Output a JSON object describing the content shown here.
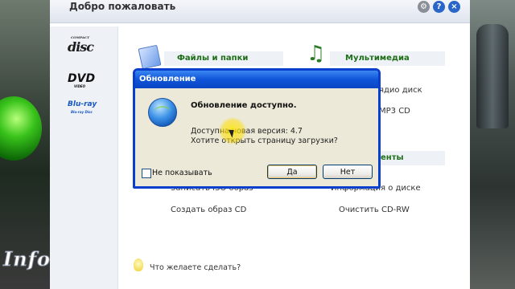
{
  "app": {
    "title": "Добро пожаловать"
  },
  "titlebar_icons": [
    "gear-icon",
    "help-icon",
    "close-icon"
  ],
  "sidebar": {
    "logos": [
      {
        "name": "compact-disc-logo",
        "text": "disc",
        "sub": "COMPACT"
      },
      {
        "name": "dvd-logo",
        "text": "DVD",
        "sub": "VIDEO"
      },
      {
        "name": "bluray-logo",
        "text": "Blu-ray",
        "sub": "Blu-ray Disc"
      }
    ],
    "watermark": "Info"
  },
  "sections": {
    "files": {
      "title": "Файлы и папки",
      "icon": "folder-icon"
    },
    "multimedia": {
      "title": "Мультимедиа",
      "icon": "music-note-icon"
    },
    "third_header_fragment": "енты"
  },
  "tasks": {
    "audio_disc_fragment": "ядио диск",
    "mp3_fragment": "MP3 CD",
    "image_fragment": "Записать ISO образ",
    "disc_info_fragment": "Информация о диске",
    "create_image": "Создать образ CD",
    "erase_cdrw": "Очистить CD-RW"
  },
  "prompt": "Что желаете сделать?",
  "dialog": {
    "title": "Обновление",
    "heading": "Обновление доступно.",
    "line1": "Доступна новая версия: 4.7",
    "line2": "Хотите открыть страницу загрузки?",
    "dont_show": "Не показывать",
    "yes": "Да",
    "no": "Нет",
    "dont_show_checked": false
  },
  "colors": {
    "accent_green": "#1d6e17",
    "xp_title_blue": "#0f55d8",
    "dialog_bg": "#ece9d8"
  }
}
